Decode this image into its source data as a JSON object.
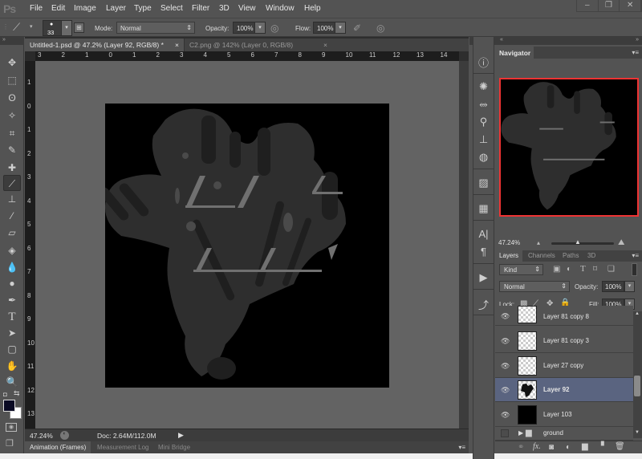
{
  "app": {
    "logo": "Ps"
  },
  "menu": [
    "File",
    "Edit",
    "Image",
    "Layer",
    "Type",
    "Select",
    "Filter",
    "3D",
    "View",
    "Window",
    "Help"
  ],
  "window_controls": {
    "minimize": "–",
    "restore": "❐",
    "close": "✕"
  },
  "options": {
    "brush_size": "33",
    "mode_label": "Mode:",
    "mode_value": "Normal",
    "opacity_label": "Opacity:",
    "opacity_value": "100%",
    "flow_label": "Flow:",
    "flow_value": "100%"
  },
  "document_tabs": [
    {
      "label": "Untitled-1.psd @ 47.2% (Layer 92, RGB/8) *",
      "close": "×"
    },
    {
      "label": "C2.png @ 142% (Layer 0, RGB/8)",
      "close": "×"
    }
  ],
  "rulers": {
    "horizontal": [
      "3",
      "2",
      "1",
      "0",
      "1",
      "2",
      "3",
      "4",
      "5",
      "6",
      "7",
      "8",
      "9",
      "10",
      "11",
      "12",
      "13",
      "14",
      "1"
    ],
    "vertical": [
      "1",
      "0",
      "1",
      "2",
      "3",
      "4",
      "5",
      "6",
      "7",
      "8",
      "9",
      "10",
      "11",
      "12",
      "13"
    ]
  },
  "status": {
    "zoom": "47.24%",
    "doc": "Doc: 2.64M/112.0M",
    "arrow": "▶"
  },
  "bottom_tabs": [
    "Animation (Frames)",
    "Measurement Log",
    "Mini Bridge"
  ],
  "colors": {
    "foreground": "#0a0a24",
    "background": "#ffffff",
    "selected_layer": "#5a6480",
    "nav_frame": "#e33333"
  },
  "navigator": {
    "title": "Navigator",
    "zoom": "47.24%"
  },
  "layers_panel": {
    "tabs": [
      "Layers",
      "Channels",
      "Paths",
      "3D"
    ],
    "filter_kind": "Kind",
    "blend_mode": "Normal",
    "opacity_label": "Opacity:",
    "opacity_value": "100%",
    "lock_label": "Lock:",
    "fill_label": "Fill:",
    "fill_value": "100%",
    "layers": [
      {
        "name": "Layer 81 copy 8",
        "thumb": "transparent",
        "visible": true,
        "selected": false
      },
      {
        "name": "Layer 81 copy 3",
        "thumb": "transparent",
        "visible": true,
        "selected": false
      },
      {
        "name": "Layer 27 copy",
        "thumb": "transparent",
        "visible": true,
        "selected": false
      },
      {
        "name": "Layer 92",
        "thumb": "shape",
        "visible": true,
        "selected": true
      },
      {
        "name": "Layer 103",
        "thumb": "black",
        "visible": true,
        "selected": false
      },
      {
        "name": "ground",
        "thumb": "folder",
        "visible": false,
        "selected": false
      }
    ]
  },
  "tools": [
    "move",
    "marquee",
    "lasso",
    "magic-wand",
    "crop",
    "eyedropper",
    "healing",
    "brush",
    "stamp",
    "history-brush",
    "eraser",
    "paint-bucket",
    "blur",
    "dodge",
    "pen",
    "type",
    "path-select",
    "shape",
    "hand",
    "zoom"
  ],
  "dock_icons": [
    "info",
    "brush-presets",
    "brushes",
    "tool-presets",
    "clone-source",
    "swatches",
    "styles",
    "table",
    "character",
    "paragraph",
    "actions",
    "history"
  ]
}
